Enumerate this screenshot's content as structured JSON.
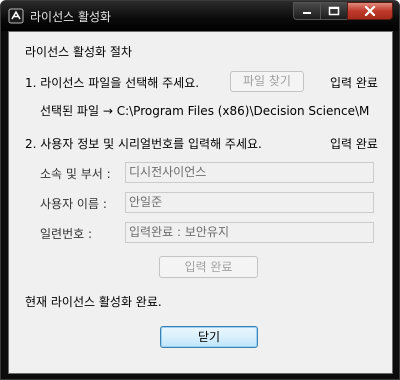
{
  "window": {
    "title": "라이선스 활성화",
    "icon": "app-icon"
  },
  "content": {
    "heading": "라이선스 활성화 절차",
    "step1": {
      "text": "1. 라이선스 파일을 선택해 주세요.",
      "button_label": "파일 찾기",
      "status": "입력 완료",
      "selected_file": "선택된 파일 → C:\\Program Files (x86)\\Decision Science\\M"
    },
    "step2": {
      "text": "2. 사용자 정보 및 시리얼번호를 입력해 주세요.",
      "status": "입력 완료",
      "dept_label": "소속 및 부서 :",
      "dept_value": "디시전사이언스",
      "name_label": "사용자 이름 :",
      "name_value": "안일준",
      "serial_label": "일련번호 :",
      "serial_value": "입력완료 : 보안유지",
      "submit_label": "입력 완료"
    },
    "status_message": "현재 라이선스 활성화 완료.",
    "close_label": "닫기"
  }
}
